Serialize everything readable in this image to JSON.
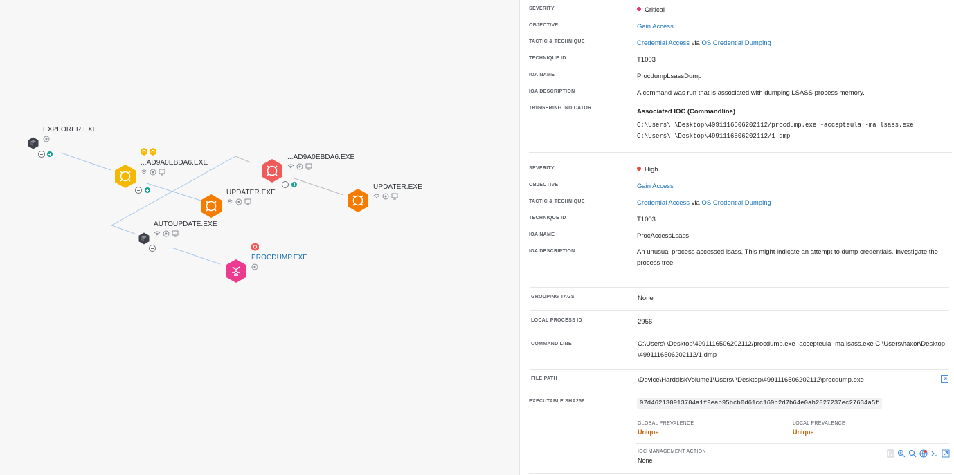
{
  "graph": {
    "nodes": [
      {
        "id": "explorer",
        "label": "EXPLORER.EXE"
      },
      {
        "id": "ad9a_1",
        "label": "...AD9A0EBDA6.EXE"
      },
      {
        "id": "ad9a_2",
        "label": "...AD9A0EBDA6.EXE"
      },
      {
        "id": "updater_1",
        "label": "UPDATER.EXE"
      },
      {
        "id": "updater_2",
        "label": "UPDATER.EXE"
      },
      {
        "id": "autoupdate",
        "label": "AUTOUPDATE.EXE"
      },
      {
        "id": "procdump",
        "label": "PROCDUMP.EXE"
      }
    ],
    "colors": {
      "yellow": "#f5b800",
      "orange": "#f57c00",
      "red": "#f05a5a",
      "pink": "#ec3a8e",
      "dark": "#3d4147",
      "teal": "#14a394",
      "edge_blue": "#a9c7ea",
      "edge_gray": "#b9bcc0"
    }
  },
  "detections": [
    {
      "severity_label": "SEVERITY",
      "severity": "Critical",
      "severity_color": "#e8336f",
      "objective_label": "OBJECTIVE",
      "objective": "Gain Access",
      "tactic_label": "TACTIC & TECHNIQUE",
      "tactic": "Credential Access",
      "via": "via",
      "technique": "OS Credential Dumping",
      "technique_id_label": "TECHNIQUE ID",
      "technique_id": "T1003",
      "ioa_name_label": "IOA NAME",
      "ioa_name": "ProcdumpLsassDump",
      "ioa_desc_label": "IOA DESCRIPTION",
      "ioa_desc": "A command was run that is associated with dumping LSASS process memory.",
      "trigger_label": "TRIGGERING INDICATOR",
      "trigger_title": "Associated IOC (Commandline)",
      "trigger_line1": "C:\\Users\\     \\Desktop\\4991116506202112/procdump.exe -accepteula -ma lsass.exe",
      "trigger_line2": "C:\\Users\\     \\Desktop\\4991116506202112/1.dmp"
    },
    {
      "severity_label": "SEVERITY",
      "severity": "High",
      "severity_color": "#e8443a",
      "objective_label": "OBJECTIVE",
      "objective": "Gain Access",
      "tactic_label": "TACTIC & TECHNIQUE",
      "tactic": "Credential Access",
      "via": "via",
      "technique": "OS Credential Dumping",
      "technique_id_label": "TECHNIQUE ID",
      "technique_id": "T1003",
      "ioa_name_label": "IOA NAME",
      "ioa_name": "ProcAccessLsass",
      "ioa_desc_label": "IOA DESCRIPTION",
      "ioa_desc": "An unusual process accessed lsass. This might indicate an attempt to dump credentials. Investigate the process tree."
    }
  ],
  "process": {
    "grouping_tags_label": "GROUPING TAGS",
    "grouping_tags": "None",
    "local_pid_label": "LOCAL PROCESS ID",
    "local_pid": "2956",
    "cmdline_label": "COMMAND LINE",
    "cmdline": "C:\\Users\\          \\Desktop\\4991116506202112/procdump.exe -accepteula -ma lsass.exe C:\\Users\\haxor\\Desktop\\4991116506202112/1.dmp",
    "file_path_label": "FILE PATH",
    "file_path": "\\Device\\HarddiskVolume1\\Users\\          \\Desktop\\4991116506202112\\procdump.exe",
    "sha_label": "EXECUTABLE SHA256",
    "sha": "97d462130913704a1f9eab95bcb0d61cc169b2d7b64e0ab2827237ec27634a5f",
    "global_prev_label": "GLOBAL PREVALENCE",
    "global_prev": "Unique",
    "local_prev_label": "LOCAL PREVALENCE",
    "local_prev": "Unique",
    "ioc_mgmt_label": "IOC MANAGEMENT ACTION",
    "ioc_mgmt": "None"
  }
}
